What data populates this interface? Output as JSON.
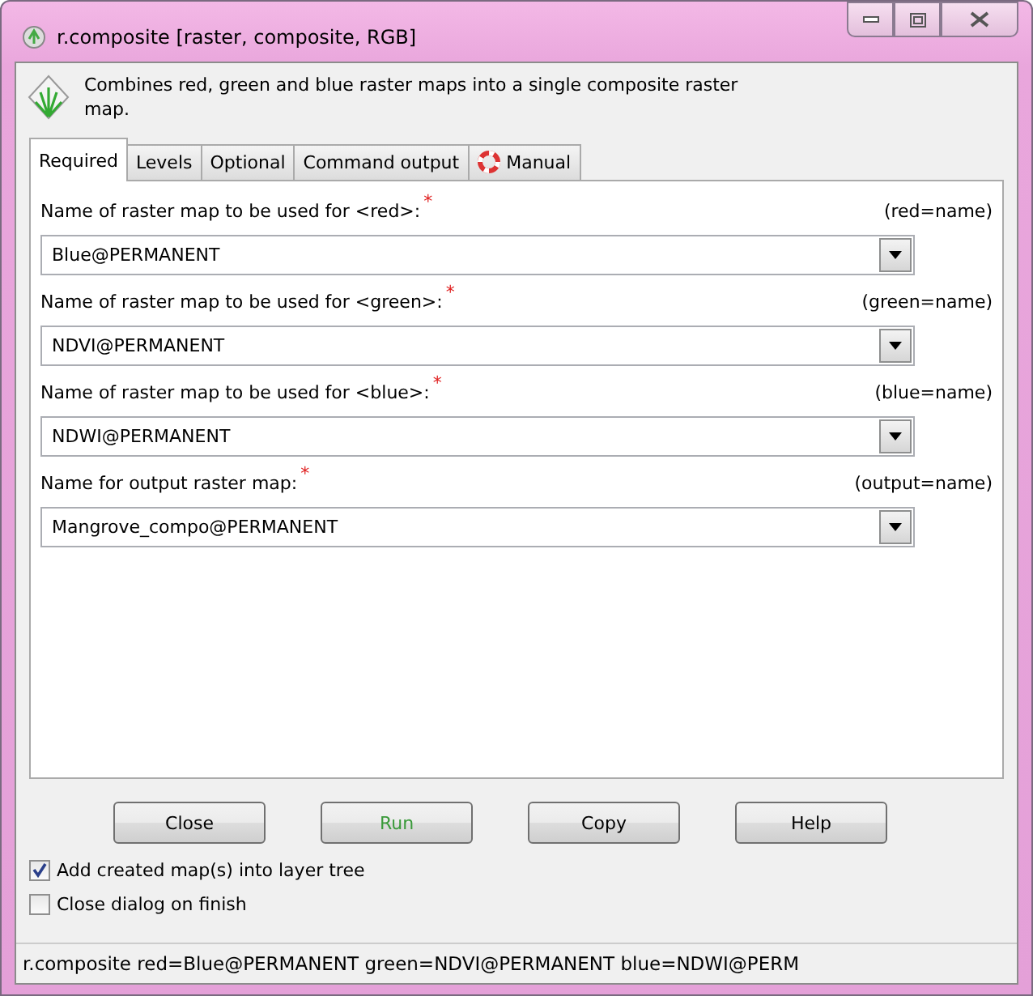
{
  "window": {
    "title": "r.composite [raster, composite, RGB]"
  },
  "description": "Combines red, green and blue raster maps into a single composite raster map.",
  "tabs": [
    {
      "label": "Required",
      "selected": true,
      "kind": "text"
    },
    {
      "label": "Levels",
      "selected": false,
      "kind": "text"
    },
    {
      "label": "Optional",
      "selected": false,
      "kind": "text"
    },
    {
      "label": "Command output",
      "selected": false,
      "kind": "text"
    },
    {
      "label": "Manual",
      "selected": false,
      "kind": "help"
    }
  ],
  "fields": [
    {
      "label": "Name of raster map to be used for <red>:",
      "mark": "*",
      "key": "(red=name)",
      "value": "Blue@PERMANENT"
    },
    {
      "label": "Name of raster map to be used for <green>:",
      "mark": "*",
      "key": "(green=name)",
      "value": "NDVI@PERMANENT"
    },
    {
      "label": "Name of raster map to be used for <blue>:",
      "mark": "*",
      "key": "(blue=name)",
      "value": "NDWI@PERMANENT"
    },
    {
      "label": "Name for output raster map:",
      "mark": "*",
      "key": "(output=name)",
      "value": "Mangrove_compo@PERMANENT"
    }
  ],
  "buttons": [
    {
      "label": "Close",
      "kind": "normal"
    },
    {
      "label": "Run",
      "kind": "run"
    },
    {
      "label": "Copy",
      "kind": "normal"
    },
    {
      "label": "Help",
      "kind": "normal"
    }
  ],
  "options": [
    {
      "label": "Add created map(s) into layer tree",
      "checked": true
    },
    {
      "label": "Close dialog on finish",
      "checked": false
    }
  ],
  "status_bar": "r.composite red=Blue@PERMANENT green=NDVI@PERMANENT blue=NDWI@PERM"
}
